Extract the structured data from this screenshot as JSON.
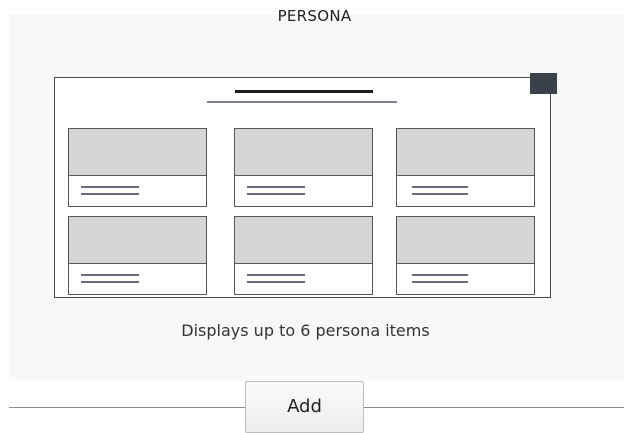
{
  "section": {
    "title": "PERSONA"
  },
  "preview": {
    "card_count": 6
  },
  "caption": "Displays up to 6 persona items",
  "actions": {
    "add_label": "Add"
  }
}
